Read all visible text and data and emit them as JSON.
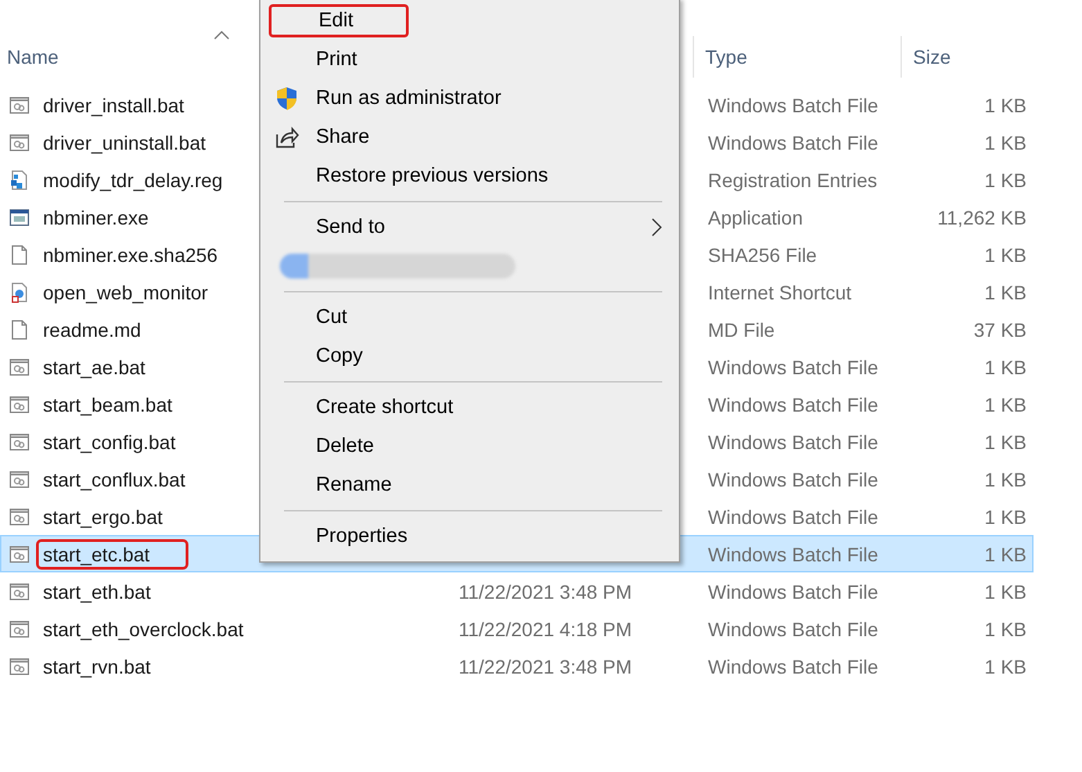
{
  "columns": [
    {
      "label": "Name",
      "sorted": true
    },
    {
      "label": "Type",
      "sorted": false
    },
    {
      "label": "Size",
      "sorted": false
    }
  ],
  "rows": [
    {
      "name": "driver_install.bat",
      "kind": "bat",
      "type": "Windows Batch File",
      "size": "1 KB",
      "selected": false,
      "annotated": false
    },
    {
      "name": "driver_uninstall.bat",
      "kind": "bat",
      "type": "Windows Batch File",
      "size": "1 KB",
      "selected": false,
      "annotated": false
    },
    {
      "name": "modify_tdr_delay.reg",
      "kind": "reg",
      "type": "Registration Entries",
      "size": "1 KB",
      "selected": false,
      "annotated": false
    },
    {
      "name": "nbminer.exe",
      "kind": "exe",
      "type": "Application",
      "size": "11,262 KB",
      "selected": false,
      "annotated": false
    },
    {
      "name": "nbminer.exe.sha256",
      "kind": "file",
      "type": "SHA256 File",
      "size": "1 KB",
      "selected": false,
      "annotated": false
    },
    {
      "name": "open_web_monitor",
      "kind": "url",
      "type": "Internet Shortcut",
      "size": "1 KB",
      "selected": false,
      "annotated": false
    },
    {
      "name": "readme.md",
      "kind": "file",
      "type": "MD File",
      "size": "37 KB",
      "selected": false,
      "annotated": false
    },
    {
      "name": "start_ae.bat",
      "kind": "bat",
      "type": "Windows Batch File",
      "size": "1 KB",
      "selected": false,
      "annotated": false
    },
    {
      "name": "start_beam.bat",
      "kind": "bat",
      "type": "Windows Batch File",
      "size": "1 KB",
      "selected": false,
      "annotated": false
    },
    {
      "name": "start_config.bat",
      "kind": "bat",
      "type": "Windows Batch File",
      "size": "1 KB",
      "selected": false,
      "annotated": false
    },
    {
      "name": "start_conflux.bat",
      "kind": "bat",
      "type": "Windows Batch File",
      "size": "1 KB",
      "selected": false,
      "annotated": false
    },
    {
      "name": "start_ergo.bat",
      "kind": "bat",
      "type": "Windows Batch File",
      "size": "1 KB",
      "selected": false,
      "annotated": false
    },
    {
      "name": "start_etc.bat",
      "kind": "bat",
      "type": "Windows Batch File",
      "size": "1 KB",
      "selected": true,
      "annotated": true
    },
    {
      "name": "start_eth.bat",
      "kind": "bat",
      "date": "11/22/2021 3:48 PM",
      "type": "Windows Batch File",
      "size": "1 KB",
      "selected": false,
      "annotated": false
    },
    {
      "name": "start_eth_overclock.bat",
      "kind": "bat",
      "date": "11/22/2021 4:18 PM",
      "type": "Windows Batch File",
      "size": "1 KB",
      "selected": false,
      "annotated": false
    },
    {
      "name": "start_rvn.bat",
      "kind": "bat",
      "date": "11/22/2021 3:48 PM",
      "type": "Windows Batch File",
      "size": "1 KB",
      "selected": false,
      "annotated": false
    }
  ],
  "context_menu": [
    {
      "kind": "item",
      "label": "Edit",
      "annotated": true
    },
    {
      "kind": "item",
      "label": "Print",
      "annotated": false
    },
    {
      "kind": "shield",
      "label": "Run as administrator",
      "annotated": false
    },
    {
      "kind": "share",
      "label": "Share",
      "annotated": false
    },
    {
      "kind": "item",
      "label": "Restore previous versions",
      "annotated": false
    },
    {
      "kind": "separator"
    },
    {
      "kind": "submenu",
      "label": "Send to",
      "annotated": false
    },
    {
      "kind": "blurred"
    },
    {
      "kind": "separator"
    },
    {
      "kind": "item",
      "label": "Cut",
      "annotated": false
    },
    {
      "kind": "item",
      "label": "Copy",
      "annotated": false
    },
    {
      "kind": "separator"
    },
    {
      "kind": "item",
      "label": "Create shortcut",
      "annotated": false
    },
    {
      "kind": "item",
      "label": "Delete",
      "annotated": false
    },
    {
      "kind": "item",
      "label": "Rename",
      "annotated": false
    },
    {
      "kind": "separator"
    },
    {
      "kind": "item",
      "label": "Properties",
      "annotated": false
    }
  ]
}
